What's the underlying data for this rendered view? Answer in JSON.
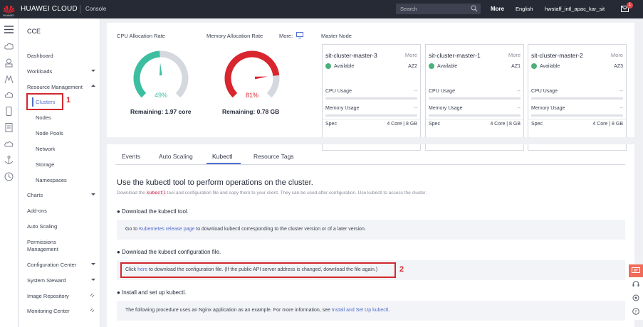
{
  "topbar": {
    "logo_text": "HUAWEI",
    "brand": "HUAWEI CLOUD",
    "console": "Console",
    "search_placeholder": "Search",
    "more": "More",
    "language": "English",
    "user": "hwstaff_intl_apac_kar_sit",
    "badge_count": "1"
  },
  "sidebar": {
    "title": "CCE",
    "items": {
      "dashboard": "Dashboard",
      "workloads": "Workloads",
      "resource_management": "Resource Management",
      "clusters": "Clusters",
      "nodes": "Nodes",
      "node_pools": "Node Pools",
      "network": "Network",
      "storage": "Storage",
      "namespaces": "Namespaces",
      "charts": "Charts",
      "addons": "Add-ons",
      "auto_scaling": "Auto Scaling",
      "permissions_1": "Permissions",
      "permissions_2": "Management",
      "configuration_center": "Configuration Center",
      "system_steward": "System Steward",
      "image_repository": "Image Repository",
      "monitoring_center": "Monitoring Center"
    }
  },
  "annotations": {
    "one": "1",
    "two": "2"
  },
  "gauges": {
    "cpu": {
      "title": "CPU Allocation Rate",
      "percent": 49,
      "percent_label": "49%",
      "remaining": "Remaining: 1.97 core",
      "color": "#3cbfa0"
    },
    "memory": {
      "title": "Memory Allocation Rate",
      "percent": 81,
      "percent_label": "81%",
      "remaining": "Remaining: 0.78 GB",
      "color": "#d9262e"
    },
    "more": "More:"
  },
  "master": {
    "title": "Master Node",
    "nodes": [
      {
        "name": "sit-cluster-master-3",
        "more": "More",
        "status": "Available",
        "az": "AZ2",
        "cpu": "CPU Usage",
        "cpu_val": "--",
        "mem": "Memory Usage",
        "mem_val": "--",
        "spec": "Spec",
        "spec_val": "4 Core | 8 GB"
      },
      {
        "name": "sit-cluster-master-1",
        "more": "More",
        "status": "Available",
        "az": "AZ1",
        "cpu": "CPU Usage",
        "cpu_val": "--",
        "mem": "Memory Usage",
        "mem_val": "--",
        "spec": "Spec",
        "spec_val": "4 Core | 8 GB"
      },
      {
        "name": "sit-cluster-master-2",
        "more": "More",
        "status": "Available",
        "az": "AZ3",
        "cpu": "CPU Usage",
        "cpu_val": "--",
        "mem": "Memory Usage",
        "mem_val": "--",
        "spec": "Spec",
        "spec_val": "4 Core | 8 GB"
      }
    ]
  },
  "tabs": {
    "events": "Events",
    "auto_scaling": "Auto Scaling",
    "kubectl": "Kubectl",
    "resource_tags": "Resource Tags"
  },
  "content": {
    "heading": "Use the kubectl tool to perform operations on the cluster.",
    "desc_pre": "Download the ",
    "desc_code": "kubectl",
    "desc_post": " tool and configuration file and copy them to your client. They can be used after configuration. Use kubectl to access the cluster.",
    "step1_title": "● Download the kubectl tool.",
    "step1_pre": "Go to ",
    "step1_link": "Kubernetes release page",
    "step1_post": " to download kubectl corresponding to the cluster version or of a later version.",
    "step2_title": "● Download the kubectl configuration file.",
    "step2_pre": "Click ",
    "step2_link": "here",
    "step2_post": " to download the configuration file. (If the public API server address is changed, download the file again.)",
    "step3_title": "● Install and set up kubectl.",
    "step3_pre": "The following procedure uses an Nginx application as an example. For more information, see ",
    "step3_link": "Install and Set Up kubectl",
    "step3_post": "."
  }
}
